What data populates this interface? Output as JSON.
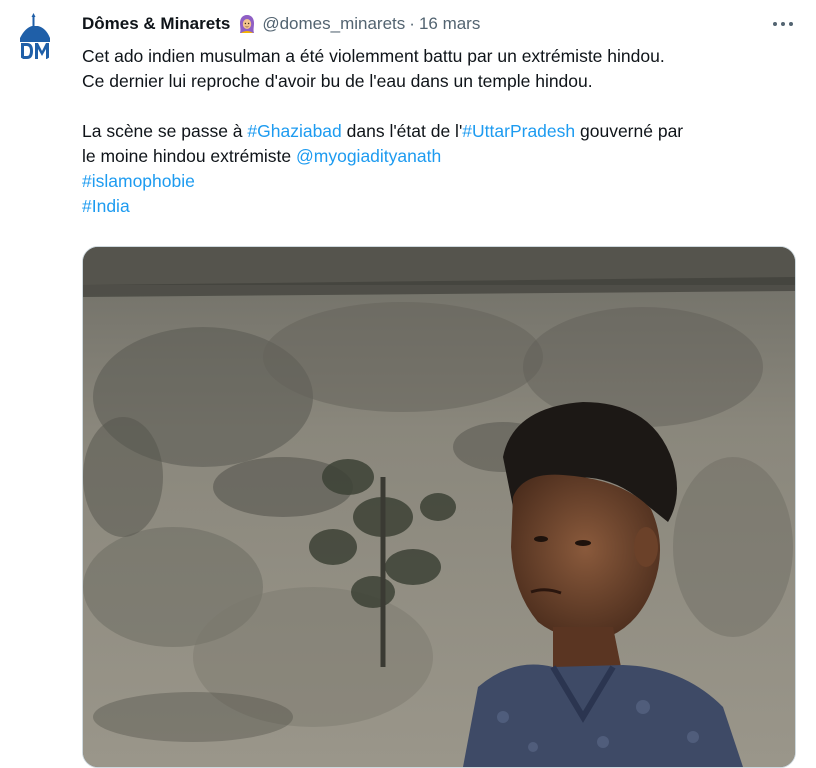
{
  "tweet": {
    "author": {
      "display_name": "Dômes & Minarets",
      "handle": "@domes_minarets",
      "avatar_icon": "domes-minarets-logo",
      "emoji_icon": "woman-with-headscarf-emoji"
    },
    "separator": "·",
    "date": "16 mars",
    "more_icon": "more-horizontal-icon",
    "text": {
      "line1": "Cet ado indien musulman a été violemment battu par un extrémiste hindou.",
      "line2": "Ce dernier lui reproche d'avoir bu de l'eau dans un temple hindou.",
      "line3_prefix": "La scène se passe à ",
      "hashtag_ghaziabad": "#Ghaziabad",
      "line3_middle": " dans l'état de l'",
      "hashtag_uttarpradesh": "#UttarPradesh",
      "line3_suffix": " gouverné par",
      "line4_prefix": "le moine hindou extrémiste ",
      "mention": "@myogiadityanath",
      "hashtag_islamophobie": "#islamophobie",
      "hashtag_india": "#India"
    },
    "media": {
      "type": "video-thumbnail"
    },
    "colors": {
      "link": "#1d9bf0",
      "secondary_text": "#536471",
      "primary_text": "#0f1419",
      "avatar_blue": "#1f5fa8"
    }
  }
}
